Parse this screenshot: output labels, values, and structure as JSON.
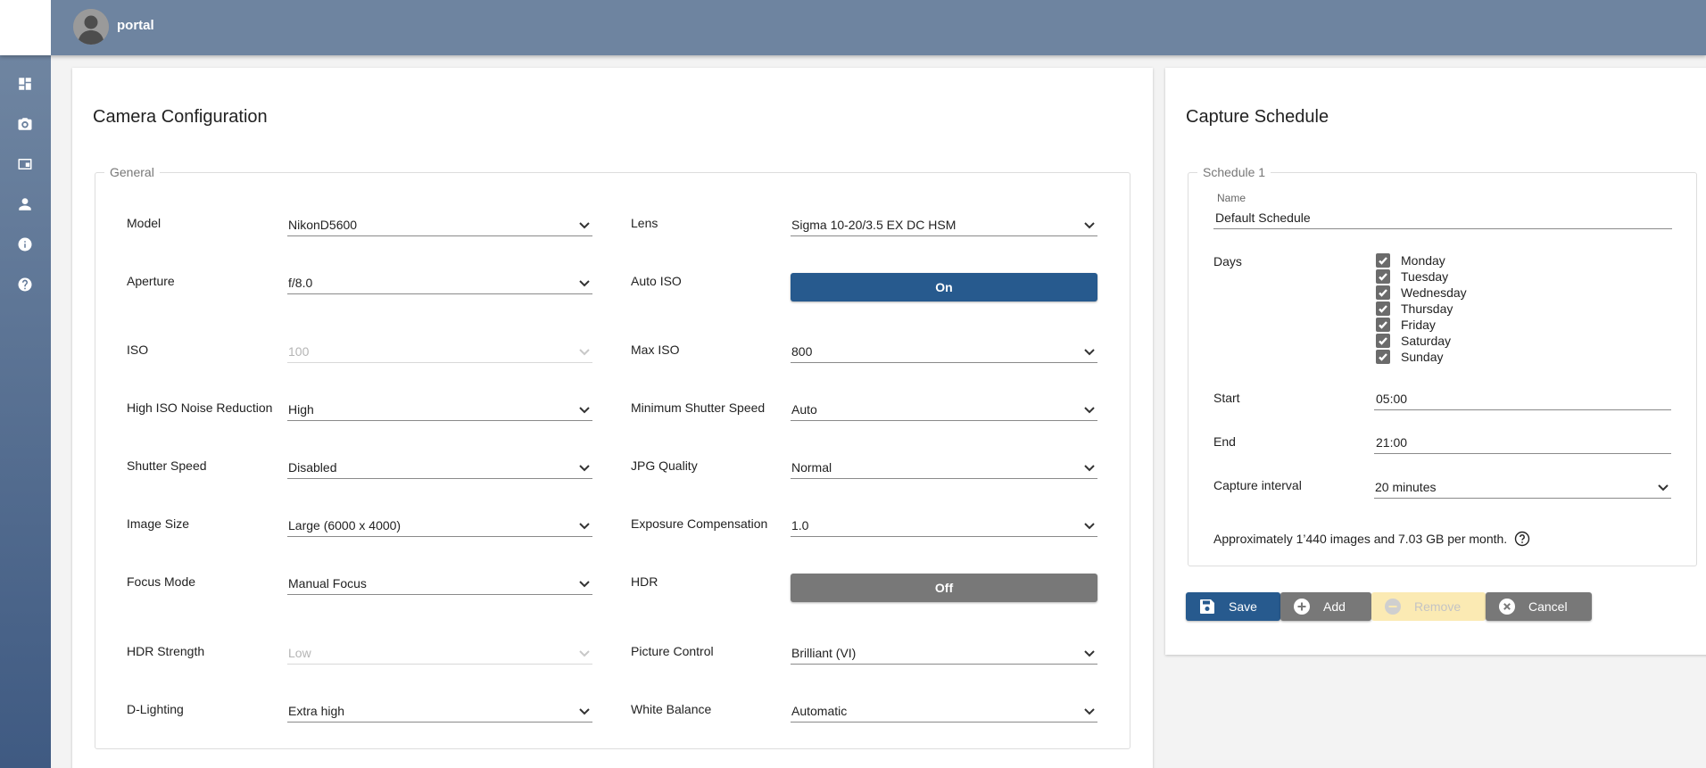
{
  "header": {
    "brand": "portal"
  },
  "sidebar": {
    "items": [
      {
        "icon": "dashboard-icon"
      },
      {
        "icon": "camera-icon"
      },
      {
        "icon": "gallery-icon"
      },
      {
        "icon": "user-icon"
      },
      {
        "icon": "info-icon"
      },
      {
        "icon": "help-icon"
      }
    ]
  },
  "camera": {
    "title": "Camera Configuration",
    "group_legend": "General",
    "left": [
      {
        "label": "Model",
        "value": "NikonD5600"
      },
      {
        "label": "Aperture",
        "value": "f/8.0"
      },
      {
        "label": "ISO",
        "value": "100"
      },
      {
        "label": "High ISO Noise Reduction",
        "value": "High"
      },
      {
        "label": "Shutter Speed",
        "value": "Disabled"
      },
      {
        "label": "Image Size",
        "value": "Large (6000 x 4000)"
      },
      {
        "label": "Focus Mode",
        "value": "Manual Focus"
      },
      {
        "label": "HDR Strength",
        "value": "Low"
      },
      {
        "label": "D-Lighting",
        "value": "Extra high"
      }
    ],
    "right": [
      {
        "label": "Lens",
        "value": "Sigma 10-20/3.5 EX DC HSM"
      },
      {
        "label": "Auto ISO",
        "value": "On"
      },
      {
        "label": "Max ISO",
        "value": "800"
      },
      {
        "label": "Minimum Shutter Speed",
        "value": "Auto"
      },
      {
        "label": "JPG Quality",
        "value": "Normal"
      },
      {
        "label": "Exposure Compensation",
        "value": "1.0"
      },
      {
        "label": "HDR",
        "value": "Off"
      },
      {
        "label": "Picture Control",
        "value": "Brilliant (VI)"
      },
      {
        "label": "White Balance",
        "value": "Automatic"
      }
    ]
  },
  "schedule": {
    "title": "Capture Schedule",
    "group_legend": "Schedule 1",
    "name_label": "Name",
    "name_value": "Default Schedule",
    "days_label": "Days",
    "days": [
      {
        "label": "Monday",
        "checked": true
      },
      {
        "label": "Tuesday",
        "checked": true
      },
      {
        "label": "Wednesday",
        "checked": true
      },
      {
        "label": "Thursday",
        "checked": true
      },
      {
        "label": "Friday",
        "checked": true
      },
      {
        "label": "Saturday",
        "checked": true
      },
      {
        "label": "Sunday",
        "checked": true
      }
    ],
    "start_label": "Start",
    "start_value": "05:00",
    "end_label": "End",
    "end_value": "21:00",
    "interval_label": "Capture interval",
    "interval_value": "20 minutes",
    "summary": "Approximately 1’440 images and 7.03 GB per month."
  },
  "buttons": {
    "save": "Save",
    "add": "Add",
    "remove": "Remove",
    "cancel": "Cancel"
  },
  "colors": {
    "primary": "#275a8e",
    "neutral": "#787878",
    "disabled_warn": "#fbeab3",
    "topbar": "#6e84a0"
  }
}
